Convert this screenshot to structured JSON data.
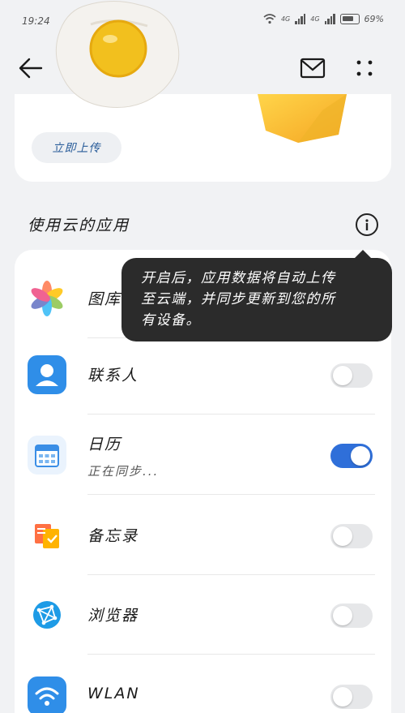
{
  "status_bar": {
    "time": "19:24",
    "network_1": "4G",
    "network_2": "4G",
    "battery": "69%"
  },
  "header": {
    "back_icon": "arrow-left-icon",
    "mail_icon": "mail-icon",
    "more_icon": "more-icon"
  },
  "top_card": {
    "upload_button": "立即上传"
  },
  "section": {
    "title": "使用云的应用",
    "info_icon": "info-icon"
  },
  "tooltip": {
    "line1": "开启后，应用数据将自动上传",
    "line2": "至云端，并同步更新到您的所",
    "line3": "有设备。"
  },
  "apps": [
    {
      "label": "图库",
      "icon": "gallery-icon",
      "toggle_on": true
    },
    {
      "label": "联系人",
      "icon": "contacts-icon",
      "toggle_on": false
    },
    {
      "label": "日历",
      "sub": "正在同步...",
      "icon": "calendar-icon",
      "toggle_on": true
    },
    {
      "label": "备忘录",
      "icon": "notes-icon",
      "toggle_on": false
    },
    {
      "label": "浏览器",
      "icon": "browser-icon",
      "toggle_on": false
    },
    {
      "label": "WLAN",
      "icon": "wlan-icon",
      "toggle_on": false
    }
  ],
  "colors": {
    "toggle_on": "#2f6fd9",
    "toggle_off": "#e6e7e9",
    "accent_text": "#2a5d9a"
  }
}
